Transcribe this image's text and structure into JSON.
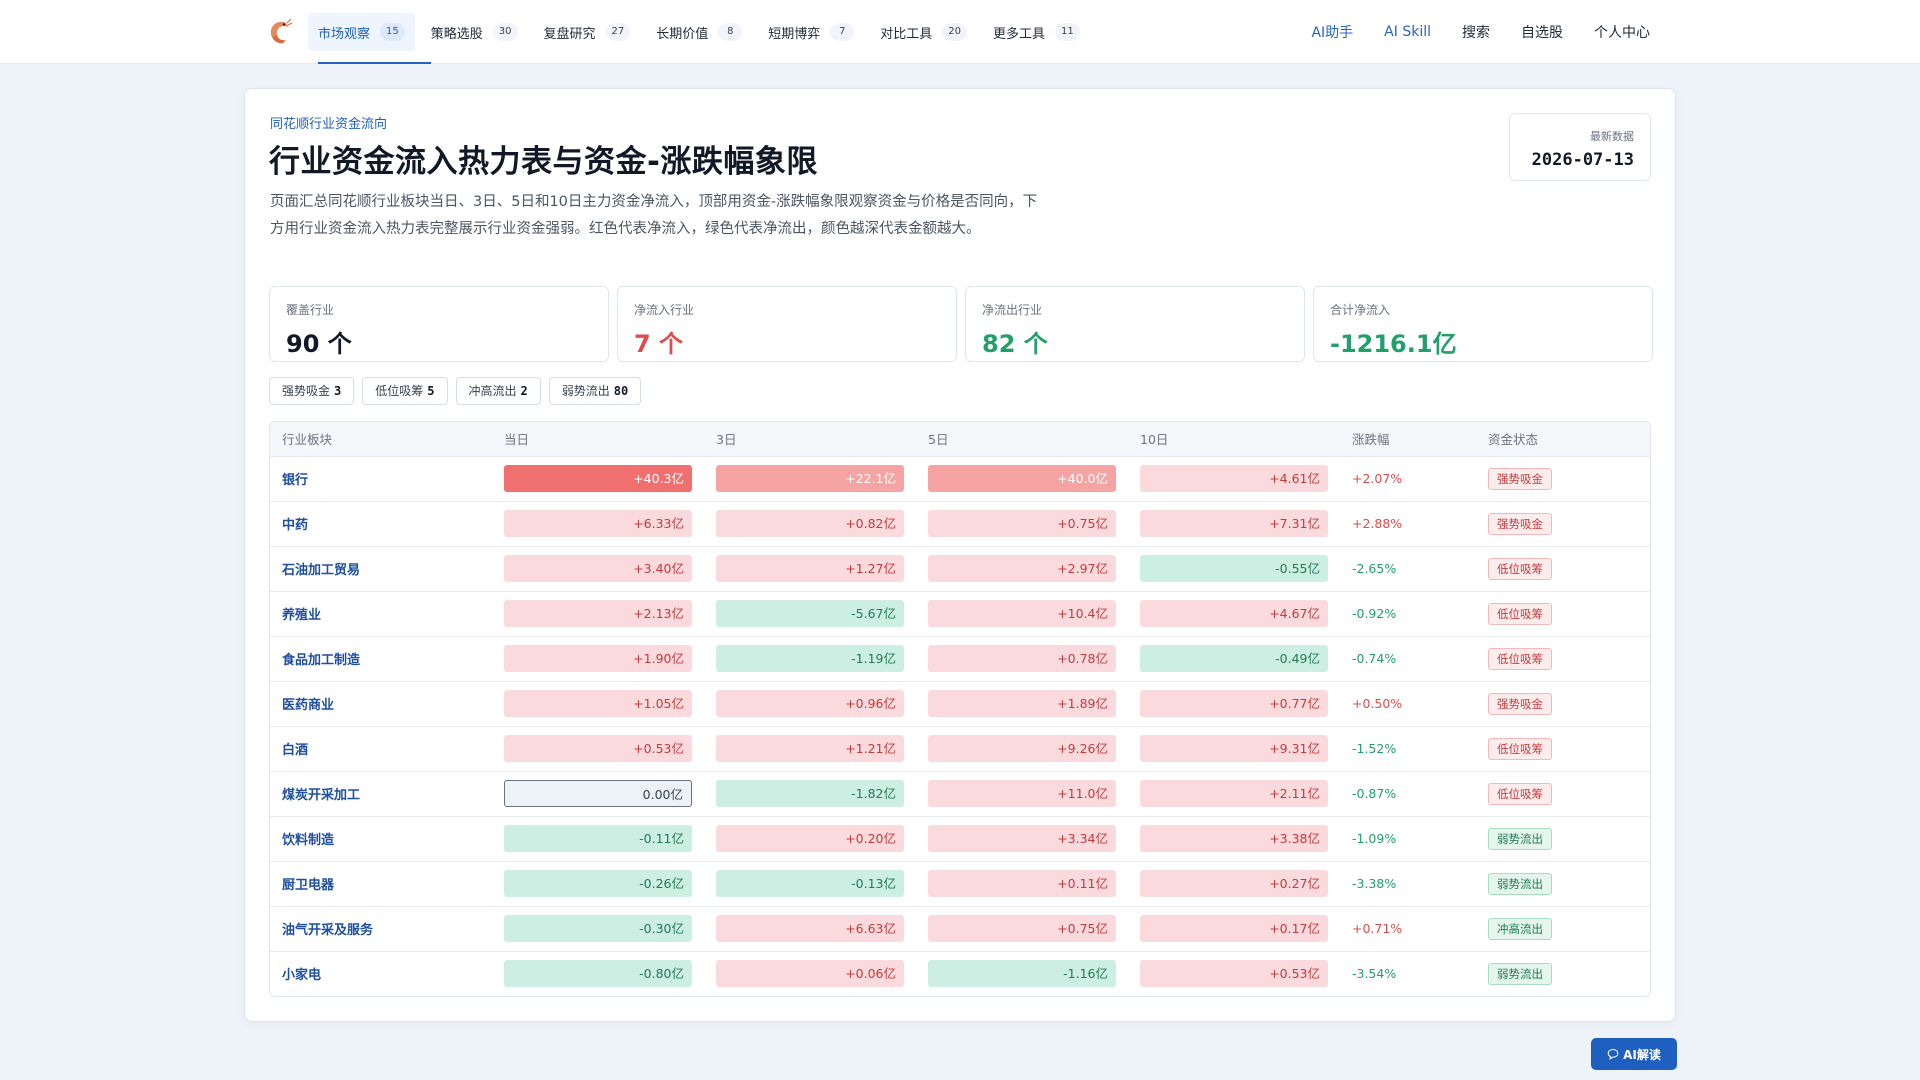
{
  "nav": {
    "tabs": [
      {
        "label": "市场观察",
        "count": "15",
        "active": true
      },
      {
        "label": "策略选股",
        "count": "30"
      },
      {
        "label": "复盘研究",
        "count": "27"
      },
      {
        "label": "长期价值",
        "count": "8"
      },
      {
        "label": "短期博弈",
        "count": "7"
      },
      {
        "label": "对比工具",
        "count": "20"
      },
      {
        "label": "更多工具",
        "count": "11"
      }
    ],
    "links": [
      "AI助手",
      "AI Skill",
      "搜索",
      "自选股",
      "个人中心"
    ]
  },
  "header": {
    "eyebrow": "同花顺行业资金流向",
    "title": "行业资金流入热力表与资金-涨跌幅象限",
    "description": "页面汇总同花顺行业板块当日、3日、5日和10日主力资金净流入，顶部用资金-涨跌幅象限观察资金与价格是否同向，下方用行业资金流入热力表完整展示行业资金强弱。红色代表净流入，绿色代表净流出，颜色越深代表金额越大。",
    "date_label": "最新数据",
    "date_value": "2026-07-13"
  },
  "stats": [
    {
      "label": "覆盖行业",
      "value": "90 个",
      "tone": "dark"
    },
    {
      "label": "净流入行业",
      "value": "7 个",
      "tone": "red"
    },
    {
      "label": "净流出行业",
      "value": "82 个",
      "tone": "green"
    },
    {
      "label": "合计净流入",
      "value": "-1216.1亿",
      "tone": "green"
    }
  ],
  "chips": [
    {
      "label": "强势吸金",
      "count": "3"
    },
    {
      "label": "低位吸筹",
      "count": "5"
    },
    {
      "label": "冲高流出",
      "count": "2"
    },
    {
      "label": "弱势流出",
      "count": "80"
    }
  ],
  "table": {
    "headers": [
      "行业板块",
      "当日",
      "3日",
      "5日",
      "10日",
      "涨跌幅",
      "资金状态"
    ],
    "rows": [
      {
        "name": "银行",
        "d1": "+40.3亿",
        "d3": "+22.1亿",
        "d5": "+40.0亿",
        "d10": "+4.61亿",
        "chg": "+2.07%",
        "status": "强势吸金",
        "tones": [
          "pos-strong",
          "pos-mid",
          "pos-mid",
          "pos-light"
        ]
      },
      {
        "name": "中药",
        "d1": "+6.33亿",
        "d3": "+0.82亿",
        "d5": "+0.75亿",
        "d10": "+7.31亿",
        "chg": "+2.88%",
        "status": "强势吸金",
        "tones": [
          "pos-light",
          "pos-light",
          "pos-light",
          "pos-light"
        ]
      },
      {
        "name": "石油加工贸易",
        "d1": "+3.40亿",
        "d3": "+1.27亿",
        "d5": "+2.97亿",
        "d10": "-0.55亿",
        "chg": "-2.65%",
        "status": "低位吸筹",
        "tones": [
          "pos-light",
          "pos-light",
          "pos-light",
          "neg-light"
        ]
      },
      {
        "name": "养殖业",
        "d1": "+2.13亿",
        "d3": "-5.67亿",
        "d5": "+10.4亿",
        "d10": "+4.67亿",
        "chg": "-0.92%",
        "status": "低位吸筹",
        "tones": [
          "pos-light",
          "neg-light",
          "pos-light",
          "pos-light"
        ]
      },
      {
        "name": "食品加工制造",
        "d1": "+1.90亿",
        "d3": "-1.19亿",
        "d5": "+0.78亿",
        "d10": "-0.49亿",
        "chg": "-0.74%",
        "status": "低位吸筹",
        "tones": [
          "pos-light",
          "neg-light",
          "pos-light",
          "neg-light"
        ]
      },
      {
        "name": "医药商业",
        "d1": "+1.05亿",
        "d3": "+0.96亿",
        "d5": "+1.89亿",
        "d10": "+0.77亿",
        "chg": "+0.50%",
        "status": "强势吸金",
        "tones": [
          "pos-light",
          "pos-light",
          "pos-light",
          "pos-light"
        ]
      },
      {
        "name": "白酒",
        "d1": "+0.53亿",
        "d3": "+1.21亿",
        "d5": "+9.26亿",
        "d10": "+9.31亿",
        "chg": "-1.52%",
        "status": "低位吸筹",
        "tones": [
          "pos-light",
          "pos-light",
          "pos-light",
          "pos-light"
        ]
      },
      {
        "name": "煤炭开采加工",
        "d1": "0.00亿",
        "d3": "-1.82亿",
        "d5": "+11.0亿",
        "d10": "+2.11亿",
        "chg": "-0.87%",
        "status": "低位吸筹",
        "tones": [
          "zero",
          "neg-light",
          "pos-light",
          "pos-light"
        ]
      },
      {
        "name": "饮料制造",
        "d1": "-0.11亿",
        "d3": "+0.20亿",
        "d5": "+3.34亿",
        "d10": "+3.38亿",
        "chg": "-1.09%",
        "status": "弱势流出",
        "tones": [
          "neg-light",
          "pos-light",
          "pos-light",
          "pos-light"
        ]
      },
      {
        "name": "厨卫电器",
        "d1": "-0.26亿",
        "d3": "-0.13亿",
        "d5": "+0.11亿",
        "d10": "+0.27亿",
        "chg": "-3.38%",
        "status": "弱势流出",
        "tones": [
          "neg-light",
          "neg-light",
          "pos-light",
          "pos-light"
        ]
      },
      {
        "name": "油气开采及服务",
        "d1": "-0.30亿",
        "d3": "+6.63亿",
        "d5": "+0.75亿",
        "d10": "+0.17亿",
        "chg": "+0.71%",
        "status": "冲高流出",
        "tones": [
          "neg-light",
          "pos-light",
          "pos-light",
          "pos-light"
        ]
      },
      {
        "name": "小家电",
        "d1": "-0.80亿",
        "d3": "+0.06亿",
        "d5": "-1.16亿",
        "d10": "+0.53亿",
        "chg": "-3.54%",
        "status": "弱势流出",
        "tones": [
          "neg-light",
          "pos-light",
          "neg-light",
          "pos-light"
        ]
      }
    ]
  },
  "ai_button": "AI解读",
  "colors": {
    "accent": "#1f5fbf",
    "inflow": "#e14b4b",
    "outflow": "#22a06b"
  }
}
